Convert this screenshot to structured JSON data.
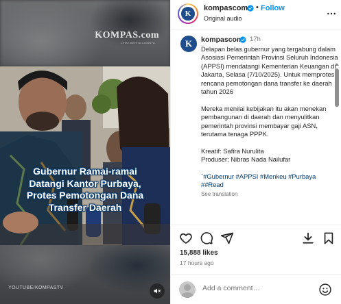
{
  "video": {
    "watermark_top": "KOMPAS.com",
    "watermark_top_sub": "LIHAT BERITA LAINNYA",
    "headline_lines": [
      "Gubernur Ramai-ramai",
      "Datangi Kantor Purbaya,",
      "Protes Pemotongan Dana",
      "Transfer Daerah"
    ],
    "watermark_bottom": "YOUTUBE/KOMPASTV",
    "mute_icon": "speaker-muted-icon"
  },
  "header": {
    "username": "kompascom",
    "verified_icon": "verified-badge-icon",
    "separator": "•",
    "follow_label": "Follow",
    "audio_label": "Original audio",
    "more_icon": "more-options-icon"
  },
  "caption": {
    "username": "kompascom",
    "time": "17h",
    "paragraphs": [
      "Delapan belas gubernur yang tergabung dalam Asosiasi Pemerintah Provinsi Seluruh Indonesia (APPSI) mendatangi Kementerian Keuangan di Jakarta, Selasa (7/10/2025). Untuk memprotes rencana pemotongan dana transfer ke daerah tahun 2026",
      "Mereka menilai kebijakan itu akan menekan pembangunan di daerah dan menyulitkan pemerintah provinsi membayar gaji ASN, terutama tenaga PPPK."
    ],
    "credit_writer": "Kreatif: Safira Nurulita",
    "credit_producer": "Produser: Nibras Nada Nailufar",
    "hashtags": "`#Gubernur #APPSI #Menkeu #Purbaya ##Read",
    "see_translation": "See translation"
  },
  "actions": {
    "like_icon": "heart-icon",
    "comment_icon": "comment-icon",
    "share_icon": "share-icon",
    "download_icon": "download-icon",
    "save_icon": "bookmark-icon",
    "likes": "15,888 likes",
    "posted": "17 hours ago"
  },
  "comment": {
    "placeholder": "Add a comment…",
    "emoji_icon": "emoji-icon"
  },
  "colors": {
    "link_blue": "#0095f6",
    "hashtag_blue": "#00376b",
    "secondary_text": "#737373",
    "kompas_blue": "#1f4d8c"
  }
}
